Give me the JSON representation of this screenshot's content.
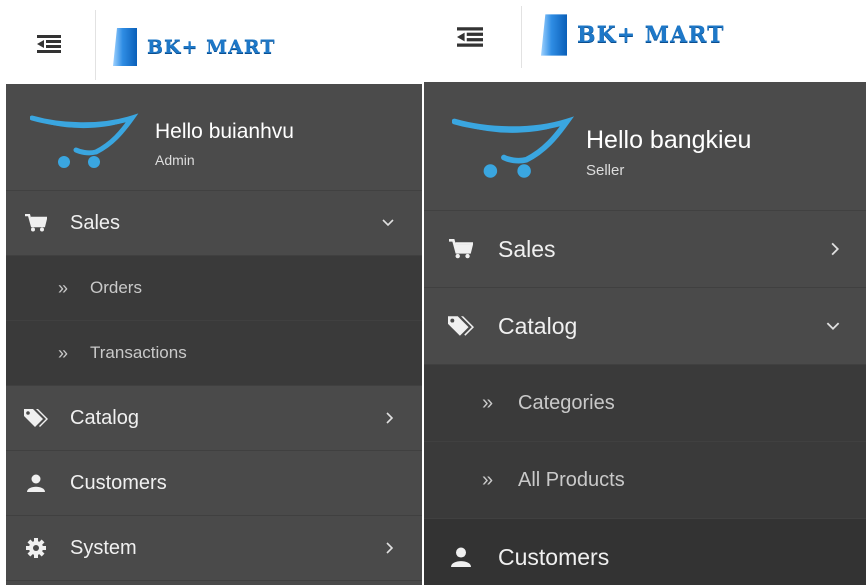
{
  "brand": {
    "name": "BK+ MART",
    "accent": "#1e78c8",
    "cart": "#3aa6e0"
  },
  "panel_left": {
    "user": {
      "name": "Hello buianhvu",
      "role": "Admin"
    },
    "menu": [
      {
        "label": "Sales",
        "icon": "cart-icon",
        "expanded": true,
        "children": [
          {
            "label": "Orders"
          },
          {
            "label": "Transactions"
          }
        ]
      },
      {
        "label": "Catalog",
        "icon": "tags-icon",
        "expanded": false
      },
      {
        "label": "Customers",
        "icon": "user-icon"
      },
      {
        "label": "System",
        "icon": "cog-icon",
        "expanded": false
      }
    ]
  },
  "panel_right": {
    "user": {
      "name": "Hello bangkieu",
      "role": "Seller"
    },
    "menu": [
      {
        "label": "Sales",
        "icon": "cart-icon",
        "expanded": false
      },
      {
        "label": "Catalog",
        "icon": "tags-icon",
        "expanded": true,
        "children": [
          {
            "label": "Categories"
          },
          {
            "label": "All Products"
          }
        ]
      },
      {
        "label": "Customers",
        "icon": "user-icon"
      }
    ]
  }
}
